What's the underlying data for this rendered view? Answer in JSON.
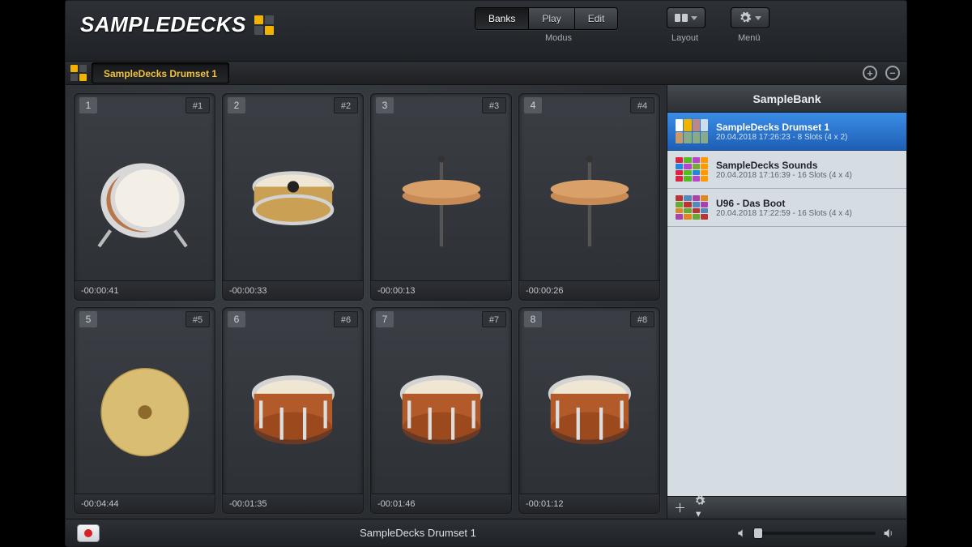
{
  "app_name": "SAMPLEDECKS",
  "header": {
    "tabs": {
      "banks": "Banks",
      "play": "Play",
      "edit": "Edit",
      "group_label": "Modus",
      "active": "banks"
    },
    "layout_label": "Layout",
    "menu_label": "Menü"
  },
  "bankbar": {
    "current_bank": "SampleDecks Drumset 1"
  },
  "pads": [
    {
      "index": "1",
      "channel": "#1",
      "time": "-00:00:41",
      "instrument": "kick"
    },
    {
      "index": "2",
      "channel": "#2",
      "time": "-00:00:33",
      "instrument": "snare"
    },
    {
      "index": "3",
      "channel": "#3",
      "time": "-00:00:13",
      "instrument": "hihat"
    },
    {
      "index": "4",
      "channel": "#4",
      "time": "-00:00:26",
      "instrument": "hihat"
    },
    {
      "index": "5",
      "channel": "#5",
      "time": "-00:04:44",
      "instrument": "cymbal"
    },
    {
      "index": "6",
      "channel": "#6",
      "time": "-00:01:35",
      "instrument": "tom"
    },
    {
      "index": "7",
      "channel": "#7",
      "time": "-00:01:46",
      "instrument": "tom"
    },
    {
      "index": "8",
      "channel": "#8",
      "time": "-00:01:12",
      "instrument": "tom"
    }
  ],
  "sidebar": {
    "title": "SampleBank",
    "items": [
      {
        "name": "SampleDecks Drumset 1",
        "meta": "20.04.2018 17:26:23 - 8 Slots (4 x 2)",
        "selected": true,
        "thumb_colors": [
          "#fff",
          "#f0b400",
          "#b88",
          "#cde",
          "#c96",
          "#8a8",
          "#8a8",
          "#8a8"
        ]
      },
      {
        "name": "SampleDecks Sounds",
        "meta": "20.04.2018 17:16:39 - 16 Slots (4 x 4)",
        "selected": false,
        "thumb_colors": [
          "#d24",
          "#5b2",
          "#b4c",
          "#f90",
          "#28d",
          "#b4c",
          "#7a3",
          "#f90",
          "#d24",
          "#5b2",
          "#28d",
          "#f90",
          "#d24",
          "#5b2",
          "#b4c",
          "#f90"
        ]
      },
      {
        "name": "U96 - Das Boot",
        "meta": "20.04.2018 17:22:59 - 16 Slots (4 x 4)",
        "selected": false,
        "thumb_colors": [
          "#b33",
          "#58b",
          "#a4a",
          "#d82",
          "#6a3",
          "#b33",
          "#58b",
          "#a4a",
          "#d82",
          "#6a3",
          "#b33",
          "#58b",
          "#a4a",
          "#d82",
          "#6a3",
          "#b33"
        ]
      }
    ]
  },
  "footer": {
    "current_title": "SampleDecks Drumset 1",
    "volume": 0
  },
  "colors": {
    "accent": "#f0b400",
    "selection": "#2a74d2"
  }
}
